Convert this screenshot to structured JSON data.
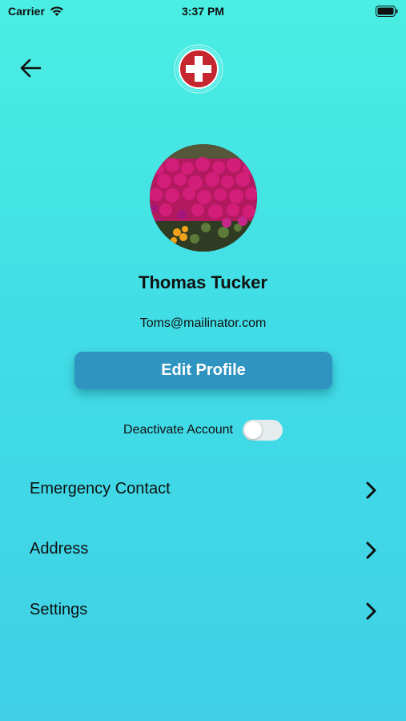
{
  "status_bar": {
    "carrier": "Carrier",
    "time": "3:37 PM"
  },
  "header": {
    "back_icon": "arrow-left-icon",
    "logo_icon": "medical-cross-icon"
  },
  "profile": {
    "name": "Thomas Tucker",
    "email": "Toms@mailinator.com"
  },
  "actions": {
    "edit_profile_label": "Edit Profile"
  },
  "deactivate": {
    "label": "Deactivate Account",
    "enabled": false
  },
  "menu": {
    "items": [
      {
        "label": "Emergency Contact"
      },
      {
        "label": "Address"
      },
      {
        "label": "Settings"
      }
    ]
  },
  "colors": {
    "background_top": "#4aeee2",
    "background_bottom": "#3fd0e6",
    "button": "#2f94bf",
    "logo_red": "#c6262e"
  }
}
